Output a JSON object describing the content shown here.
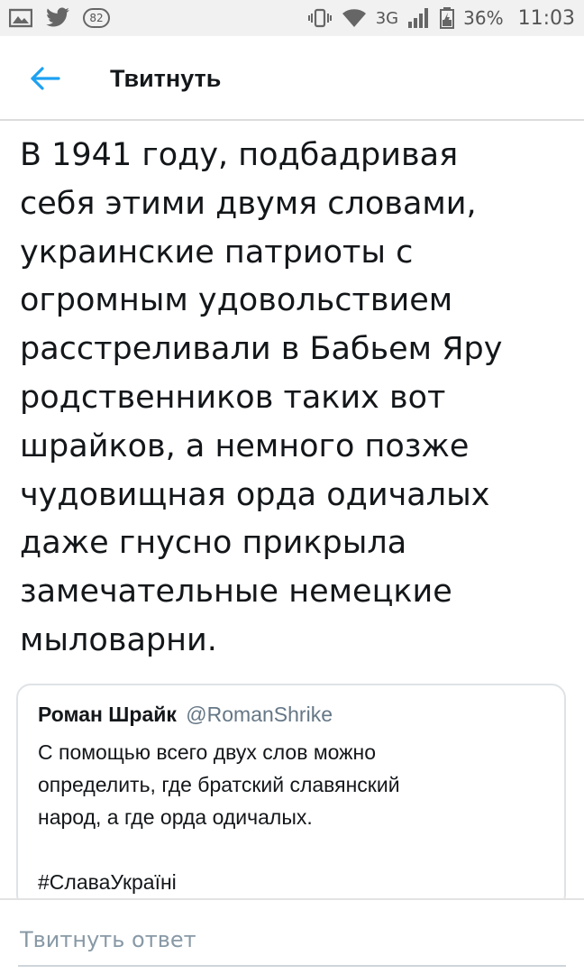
{
  "status_bar": {
    "notification_count": "82",
    "network": "3G",
    "battery": "36%",
    "time": "11:03",
    "icons": [
      "gallery-icon",
      "twitter-bird-icon",
      "vibrate-icon",
      "wifi-icon",
      "signal-icon",
      "battery-icon"
    ]
  },
  "header": {
    "back_icon": "arrow-left-icon",
    "title": "Твитнуть"
  },
  "tweet": {
    "text": "В 1941 году, подбадривая\nсебя этими двумя словами,\nукраинские патриоты с\nогромным удовольствием\nрасстреливали в Бабьем Яру\nродственников таких вот\nшрайков, а немного позже\nчудовищная орда одичалых\nдаже гнусно прикрыла\nзамечательные немецкие\nмыловарни."
  },
  "quoted_tweet": {
    "name": "Роман Шрайк",
    "handle": "@RomanShrike",
    "lines": [
      "С помощью всего двух слов можно",
      "определить, где братский славянский",
      "народ, а где орда одичалых."
    ],
    "hashtag": "#СлаваУкраїні"
  },
  "reply": {
    "placeholder": "Твитнуть ответ"
  },
  "colors": {
    "accent": "#1da1f2",
    "text": "#14171a",
    "secondary": "#657786",
    "status_bar_bg": "#f1f1f1",
    "border": "#dfe3e6"
  }
}
